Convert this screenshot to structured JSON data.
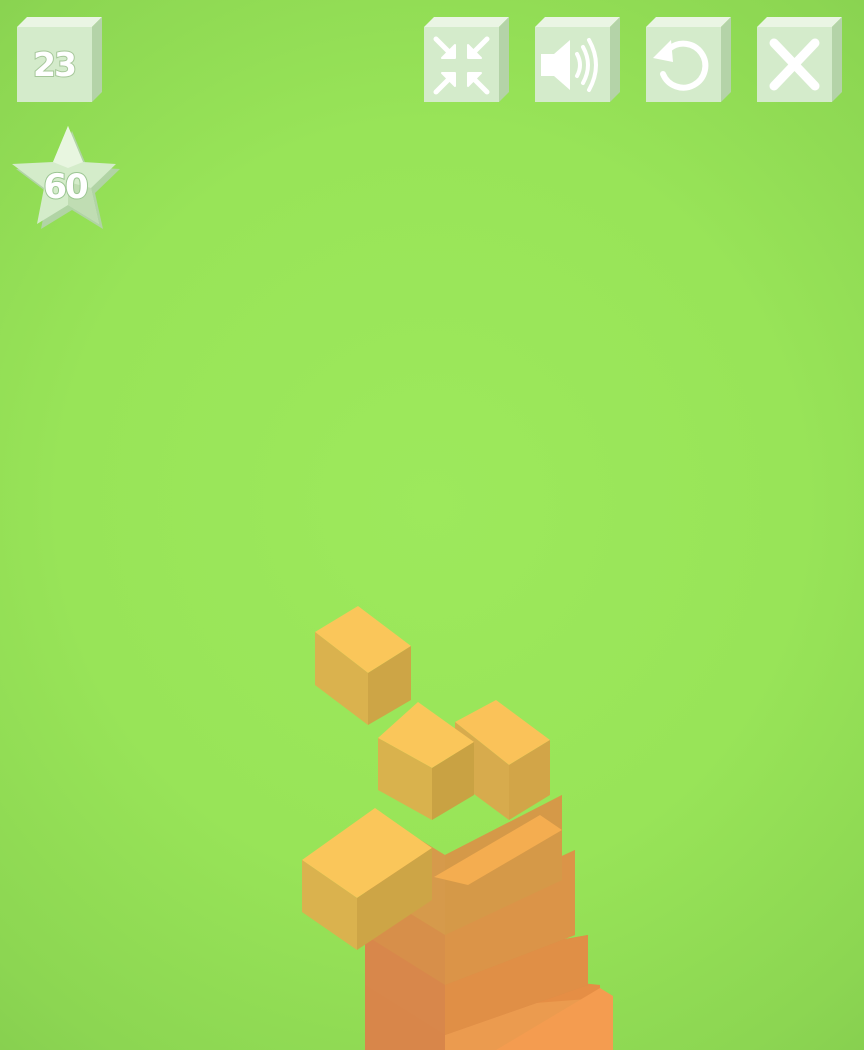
{
  "hud": {
    "score": "23",
    "stars": "60"
  },
  "buttons": [
    {
      "name": "exit-fullscreen-button",
      "icon": "compress-arrows-icon"
    },
    {
      "name": "sound-button",
      "icon": "speaker-on-icon"
    },
    {
      "name": "restart-button",
      "icon": "restart-arrow-icon"
    },
    {
      "name": "close-button",
      "icon": "close-x-icon"
    }
  ],
  "colors": {
    "background": "#9de95c",
    "hud_button": "#d8ecd0",
    "block_top": "#fac65a",
    "block_left": "#d9b24d",
    "block_right": "#c8a243",
    "tower_orange": "#f2a24d"
  }
}
